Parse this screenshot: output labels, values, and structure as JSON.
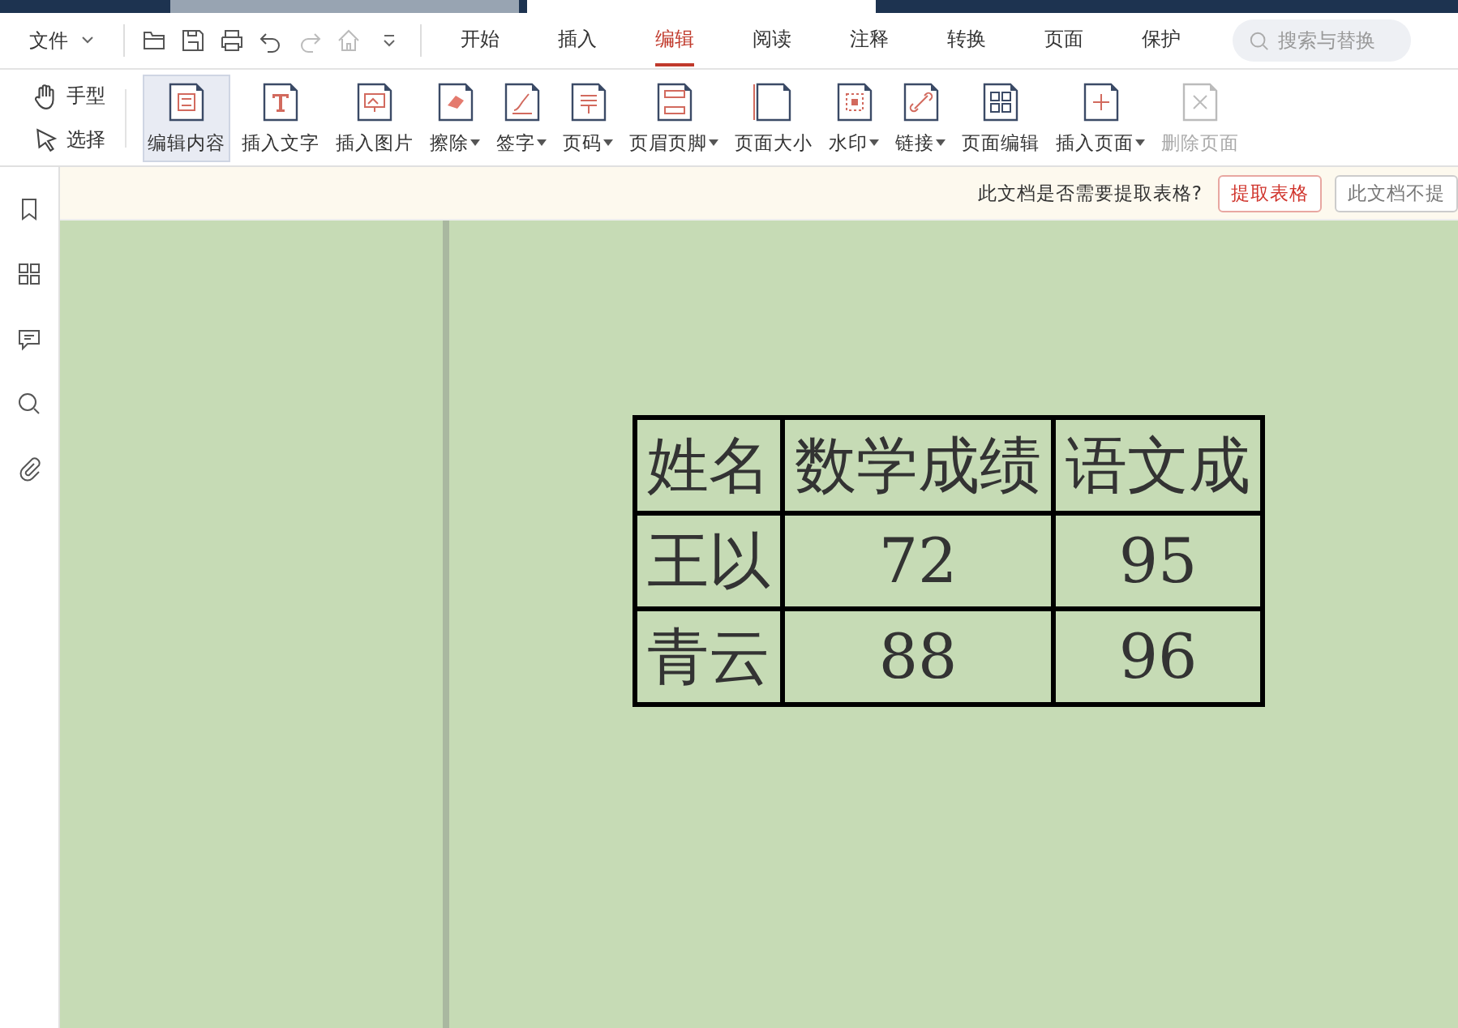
{
  "menu": {
    "file": "文件"
  },
  "tabs": [
    {
      "label": "开始",
      "selected": false
    },
    {
      "label": "插入",
      "selected": false
    },
    {
      "label": "编辑",
      "selected": true
    },
    {
      "label": "阅读",
      "selected": false
    },
    {
      "label": "注释",
      "selected": false
    },
    {
      "label": "转换",
      "selected": false
    },
    {
      "label": "页面",
      "selected": false
    },
    {
      "label": "保护",
      "selected": false
    }
  ],
  "search": {
    "placeholder": "搜索与替换"
  },
  "modes": [
    {
      "label": "手型"
    },
    {
      "label": "选择"
    }
  ],
  "tools": [
    {
      "label": "编辑内容",
      "selected": true,
      "dropdown": false,
      "disabled": false
    },
    {
      "label": "插入文字",
      "selected": false,
      "dropdown": false,
      "disabled": false
    },
    {
      "label": "插入图片",
      "selected": false,
      "dropdown": false,
      "disabled": false
    },
    {
      "label": "擦除",
      "selected": false,
      "dropdown": true,
      "disabled": false
    },
    {
      "label": "签字",
      "selected": false,
      "dropdown": true,
      "disabled": false
    },
    {
      "label": "页码",
      "selected": false,
      "dropdown": true,
      "disabled": false
    },
    {
      "label": "页眉页脚",
      "selected": false,
      "dropdown": true,
      "disabled": false
    },
    {
      "label": "页面大小",
      "selected": false,
      "dropdown": false,
      "disabled": false
    },
    {
      "label": "水印",
      "selected": false,
      "dropdown": true,
      "disabled": false
    },
    {
      "label": "链接",
      "selected": false,
      "dropdown": true,
      "disabled": false
    },
    {
      "label": "页面编辑",
      "selected": false,
      "dropdown": false,
      "disabled": false
    },
    {
      "label": "插入页面",
      "selected": false,
      "dropdown": true,
      "disabled": false
    },
    {
      "label": "删除页面",
      "selected": false,
      "dropdown": false,
      "disabled": true
    }
  ],
  "notice": {
    "text": "此文档是否需要提取表格?",
    "buttons": [
      {
        "label": "提取表格",
        "kind": "primary"
      },
      {
        "label": "此文档不提",
        "kind": "secondary"
      }
    ]
  },
  "table": {
    "rows": [
      [
        "姓名",
        "数学成绩",
        "语文成"
      ],
      [
        "王以",
        "72",
        "95"
      ],
      [
        "青云",
        "88",
        "96"
      ]
    ]
  }
}
